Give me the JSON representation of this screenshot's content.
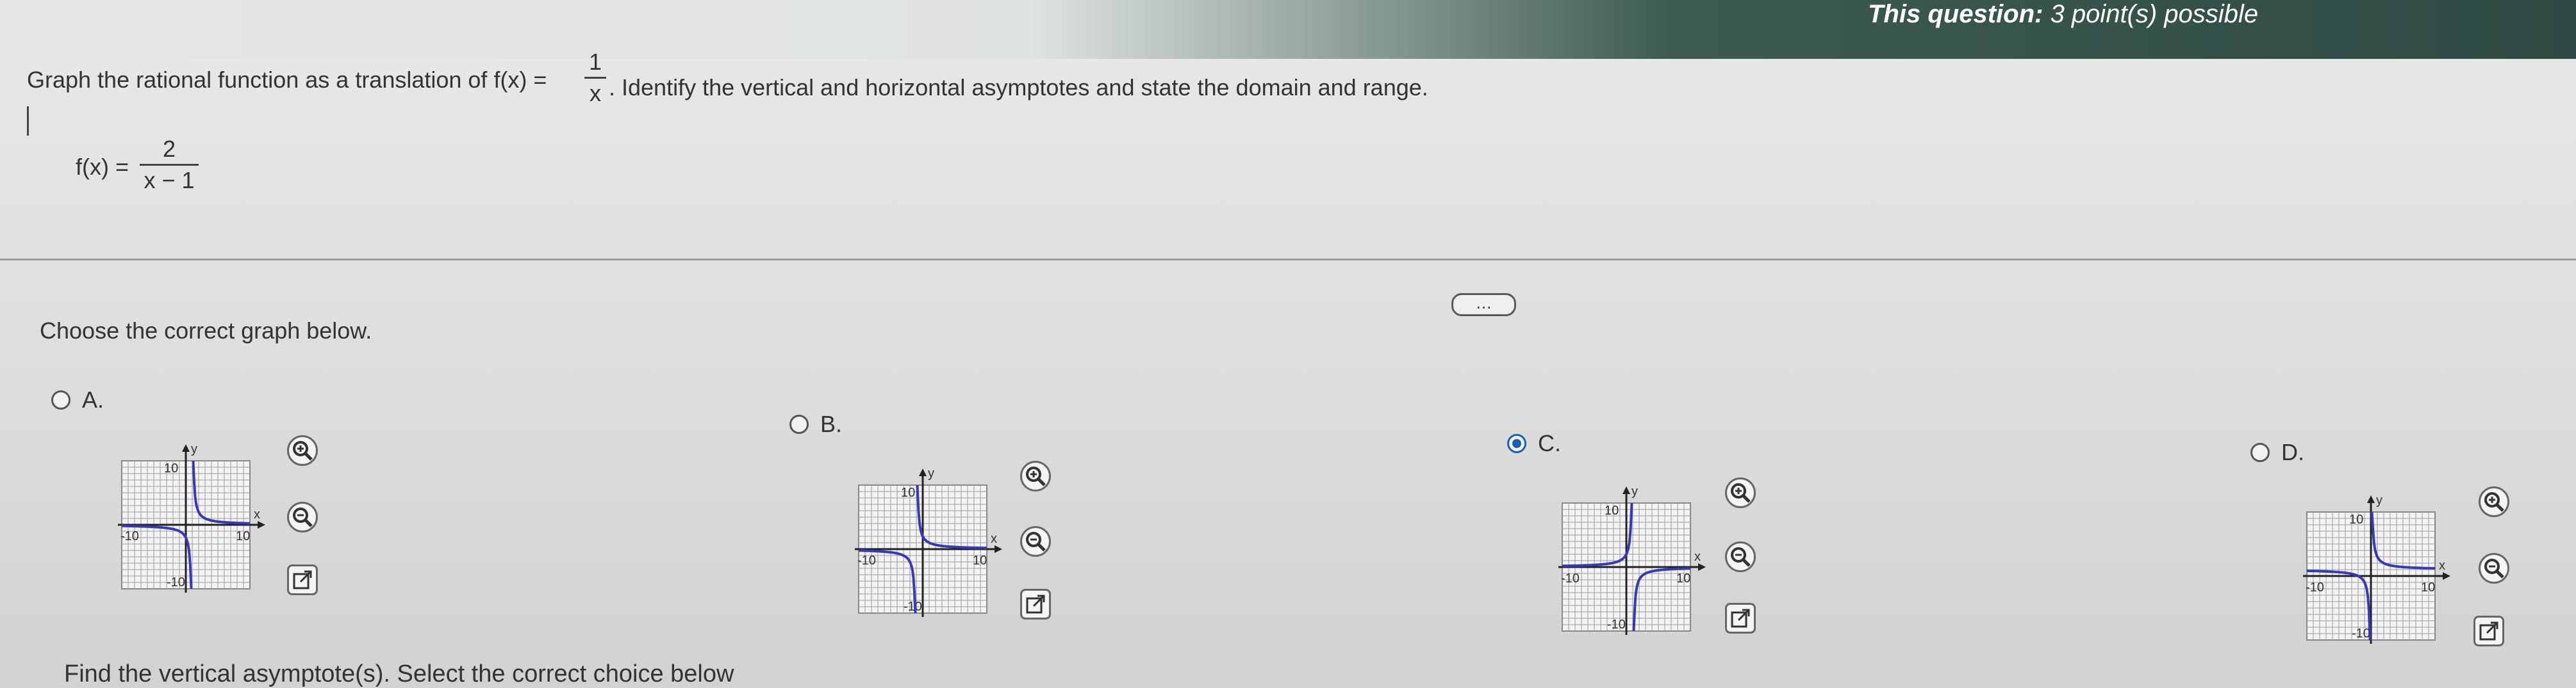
{
  "header": {
    "points_label": "This question:",
    "points_value": "3 point(s) possible"
  },
  "question": {
    "text_before": "Graph the rational function as a translation of f(x) =",
    "parent_num": "1",
    "parent_den": "x",
    "text_after": ". Identify the vertical and horizontal asymptotes and state the domain and range.",
    "func_prefix": "f(x) =",
    "func_num": "2",
    "func_den": "x − 1"
  },
  "more_button": "…",
  "prompt": "Choose the correct graph below.",
  "options": [
    {
      "label": "A.",
      "selected": false
    },
    {
      "label": "B.",
      "selected": false
    },
    {
      "label": "C.",
      "selected": true
    },
    {
      "label": "D.",
      "selected": false
    }
  ],
  "graph_labels": {
    "y": "y",
    "x": "x",
    "tick_pos": "10",
    "tick_neg": "-10"
  },
  "icons": {
    "zoom_in": "zoom-in-icon",
    "zoom_out": "zoom-out-icon",
    "popout": "external-link-icon"
  },
  "colors": {
    "curve": "#3a37b8",
    "selected_radio": "#1b5fb5",
    "header_dark": "#2f4a44"
  },
  "bottom_text": "Find the vertical asymptote(s). Select the correct choice below"
}
